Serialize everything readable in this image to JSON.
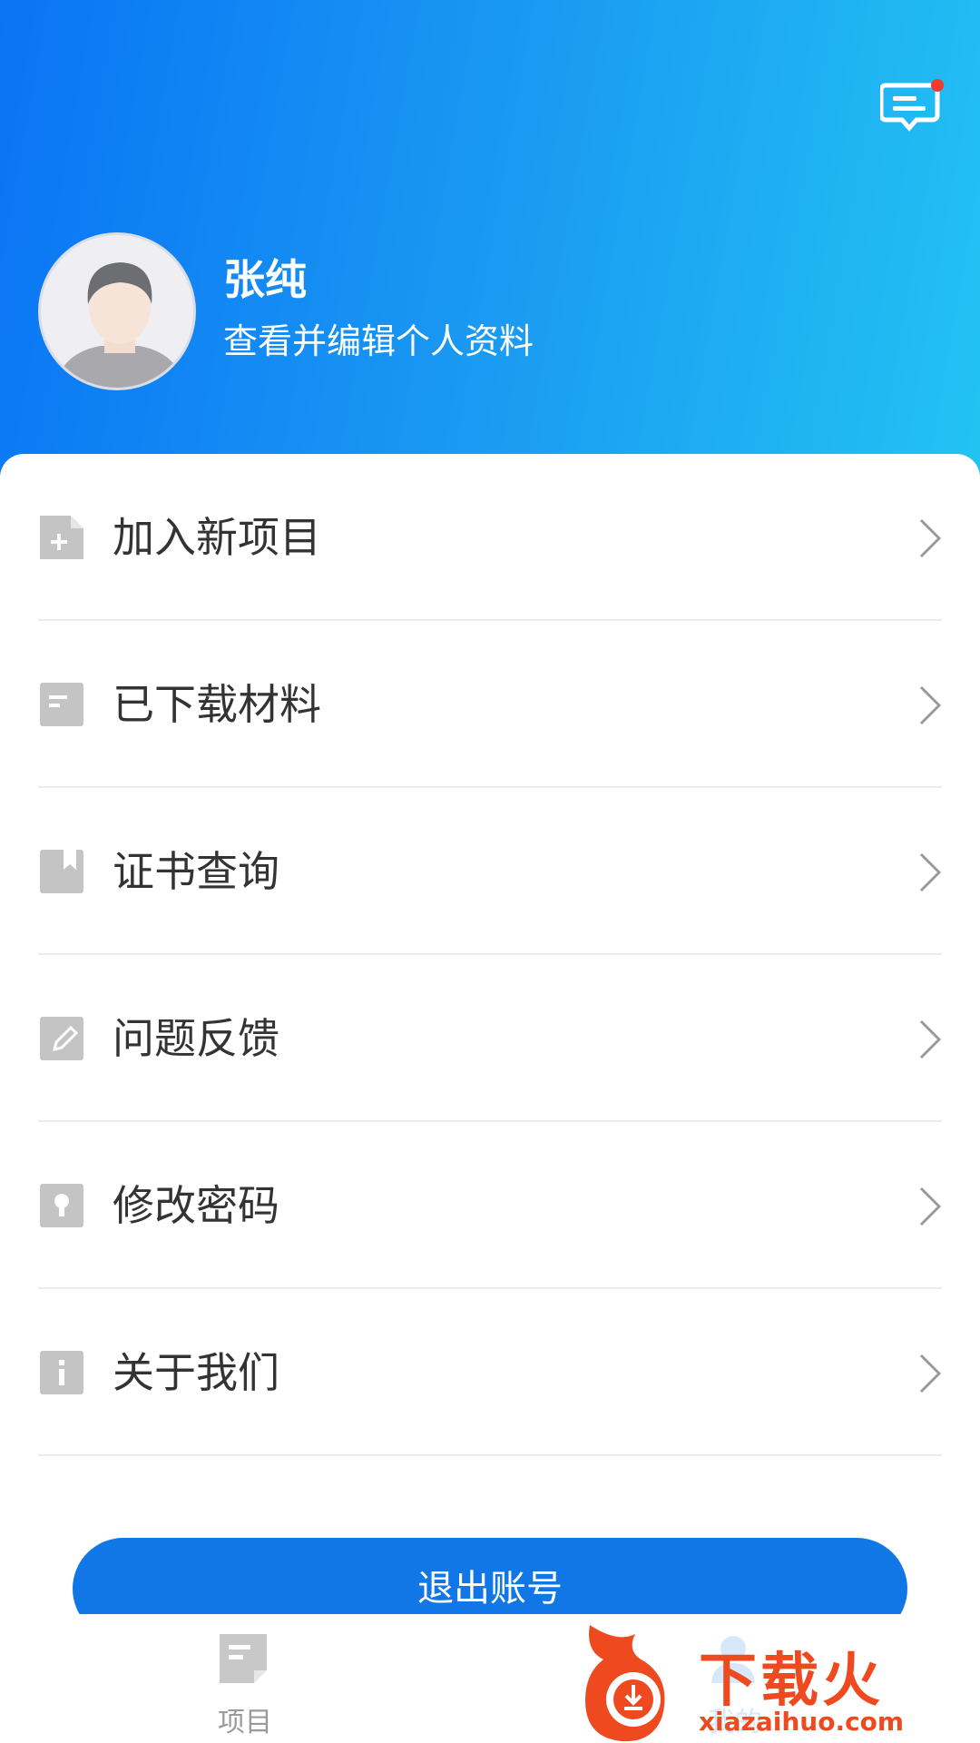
{
  "header": {
    "user_name": "张纯",
    "user_subtitle": "查看并编辑个人资料",
    "message_icon": "message-notification-icon",
    "has_unread": true
  },
  "menu": [
    {
      "label": "加入新项目",
      "icon": "add-file-icon"
    },
    {
      "label": "已下载材料",
      "icon": "document-icon"
    },
    {
      "label": "证书查询",
      "icon": "bookmark-icon"
    },
    {
      "label": "问题反馈",
      "icon": "edit-icon"
    },
    {
      "label": "修改密码",
      "icon": "lock-icon"
    },
    {
      "label": "关于我们",
      "icon": "info-icon"
    }
  ],
  "logout_label": "退出账号",
  "tabbar": {
    "tabs": [
      {
        "label": "项目",
        "icon": "project-icon",
        "active": false
      },
      {
        "label": "我的",
        "icon": "profile-icon",
        "active": true
      }
    ]
  },
  "watermark": {
    "text": "下载火",
    "url": "xiazaihuo.com"
  },
  "colors": {
    "header_start": "#0a74f5",
    "header_end": "#22c3f3",
    "button": "#1277e6",
    "icon_gray": "#c4c4c4",
    "watermark": "#ef4a1f"
  }
}
